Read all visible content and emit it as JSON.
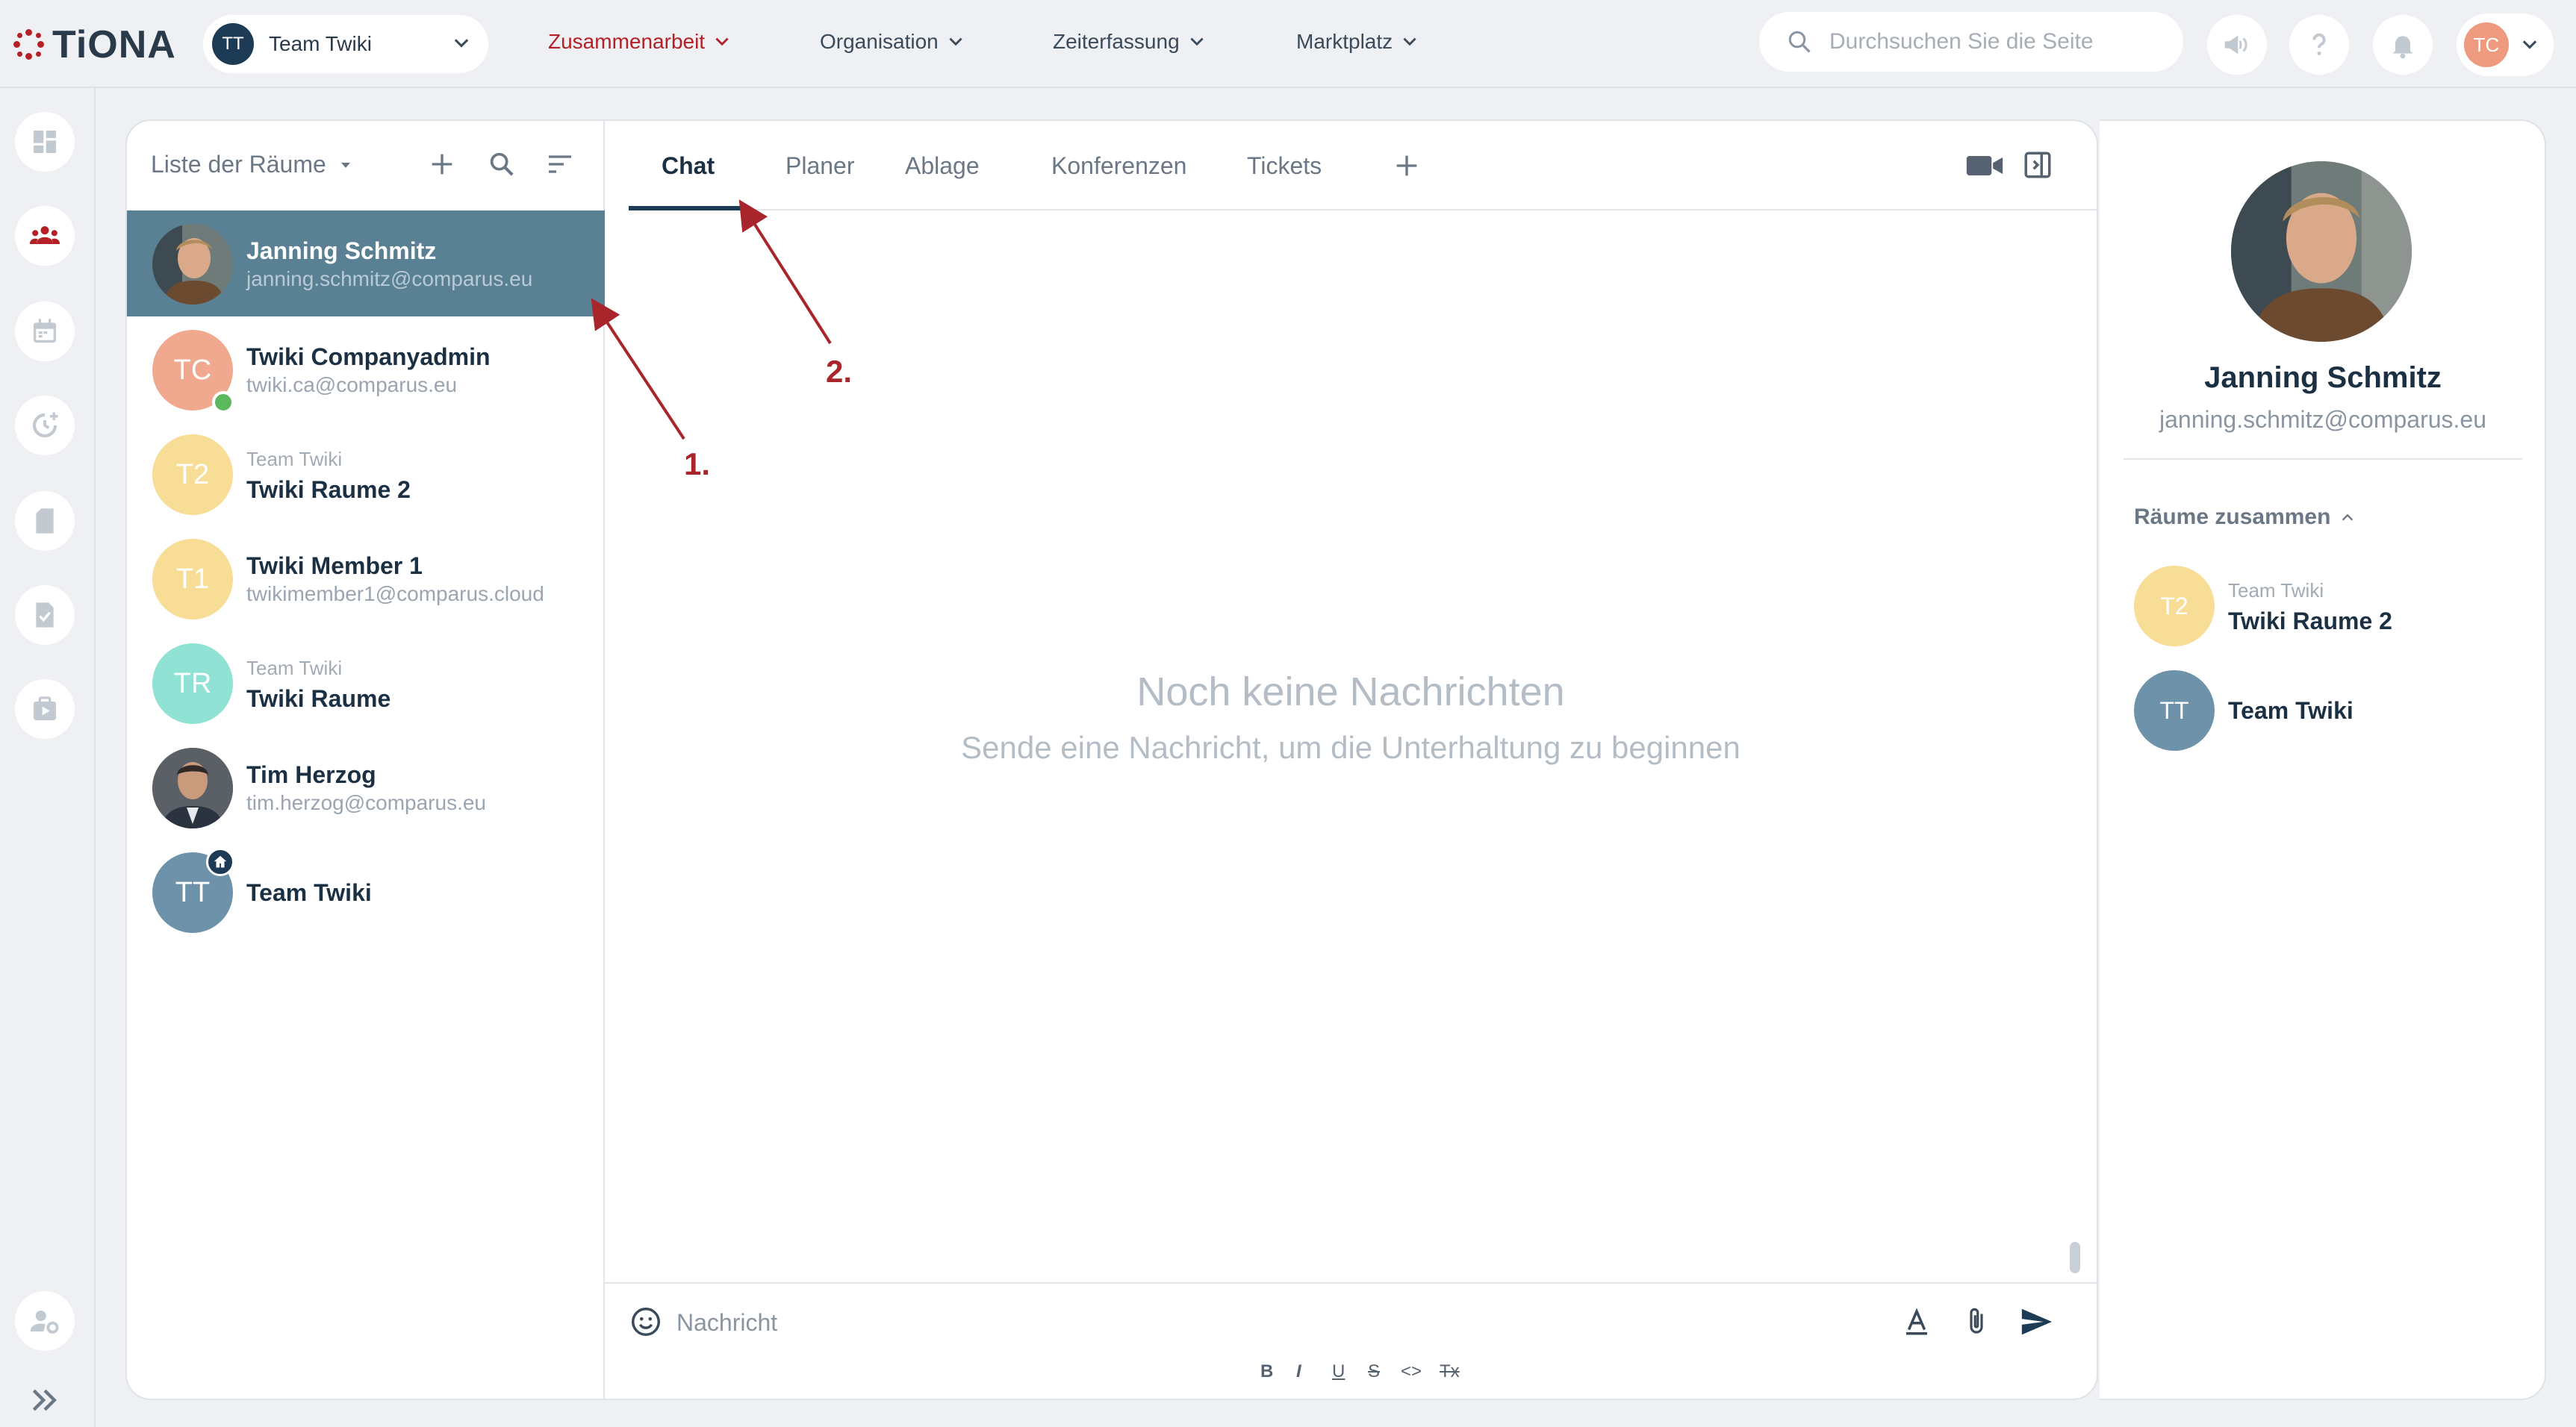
{
  "app": {
    "logo_text": "TiONA",
    "brand_color": "#b32025"
  },
  "header": {
    "team_avatar": "TT",
    "team_name": "Team Twiki",
    "nav": [
      "Zusammenarbeit",
      "Organisation",
      "Zeiterfassung",
      "Marktplatz"
    ],
    "search_placeholder": "Durchsuchen Sie die Seite",
    "user_initials": "TC",
    "icons": [
      "megaphone-icon",
      "help-icon",
      "bell-icon"
    ]
  },
  "sidebar_icons": [
    "dashboard-icon",
    "people-icon",
    "calendar-icon",
    "time-icon",
    "document-icon",
    "task-icon",
    "media-icon",
    "user-settings-icon",
    "expand-icon"
  ],
  "rooms": {
    "header": "Liste der Räume",
    "items": [
      {
        "initials": "",
        "name": "Janning Schmitz",
        "sub": "janning.schmitz@comparus.eu",
        "selected": true,
        "photo": true
      },
      {
        "initials": "TC",
        "name": "Twiki Companyadmin",
        "sub": "twiki.ca@comparus.eu",
        "color": "#f0a88f",
        "online": true
      },
      {
        "initials": "T2",
        "pre": "Team Twiki",
        "name": "Twiki Raume 2",
        "color": "#f7dd96"
      },
      {
        "initials": "T1",
        "name": "Twiki Member 1",
        "sub": "twikimember1@comparus.cloud",
        "color": "#f7dd96"
      },
      {
        "initials": "TR",
        "pre": "Team Twiki",
        "name": "Twiki Raume",
        "color": "#8fe2d4"
      },
      {
        "initials": "",
        "name": "Tim Herzog",
        "sub": "tim.herzog@comparus.eu",
        "photo": true
      },
      {
        "initials": "TT",
        "name": "Team Twiki",
        "color": "#6d92a9",
        "home": true
      }
    ]
  },
  "chat": {
    "tabs": [
      "Chat",
      "Planer",
      "Ablage",
      "Konferenzen",
      "Tickets"
    ],
    "active_tab": "Chat",
    "empty_title": "Noch keine Nachrichten",
    "empty_subtitle": "Sende eine Nachricht, um die Unterhaltung zu beginnen",
    "composer_placeholder": "Nachricht",
    "format_buttons": [
      "B",
      "I",
      "U",
      "S",
      "<>",
      "Tx"
    ]
  },
  "details": {
    "name": "Janning Schmitz",
    "email": "janning.schmitz@comparus.eu",
    "section": "Räume zusammen",
    "rooms": [
      {
        "initials": "T2",
        "pre": "Team Twiki",
        "name": "Twiki Raume 2",
        "color": "#f7dd96"
      },
      {
        "initials": "TT",
        "name": "Team Twiki",
        "color": "#6d92a9"
      }
    ]
  },
  "annotations": {
    "a1": "1.",
    "a2": "2."
  }
}
